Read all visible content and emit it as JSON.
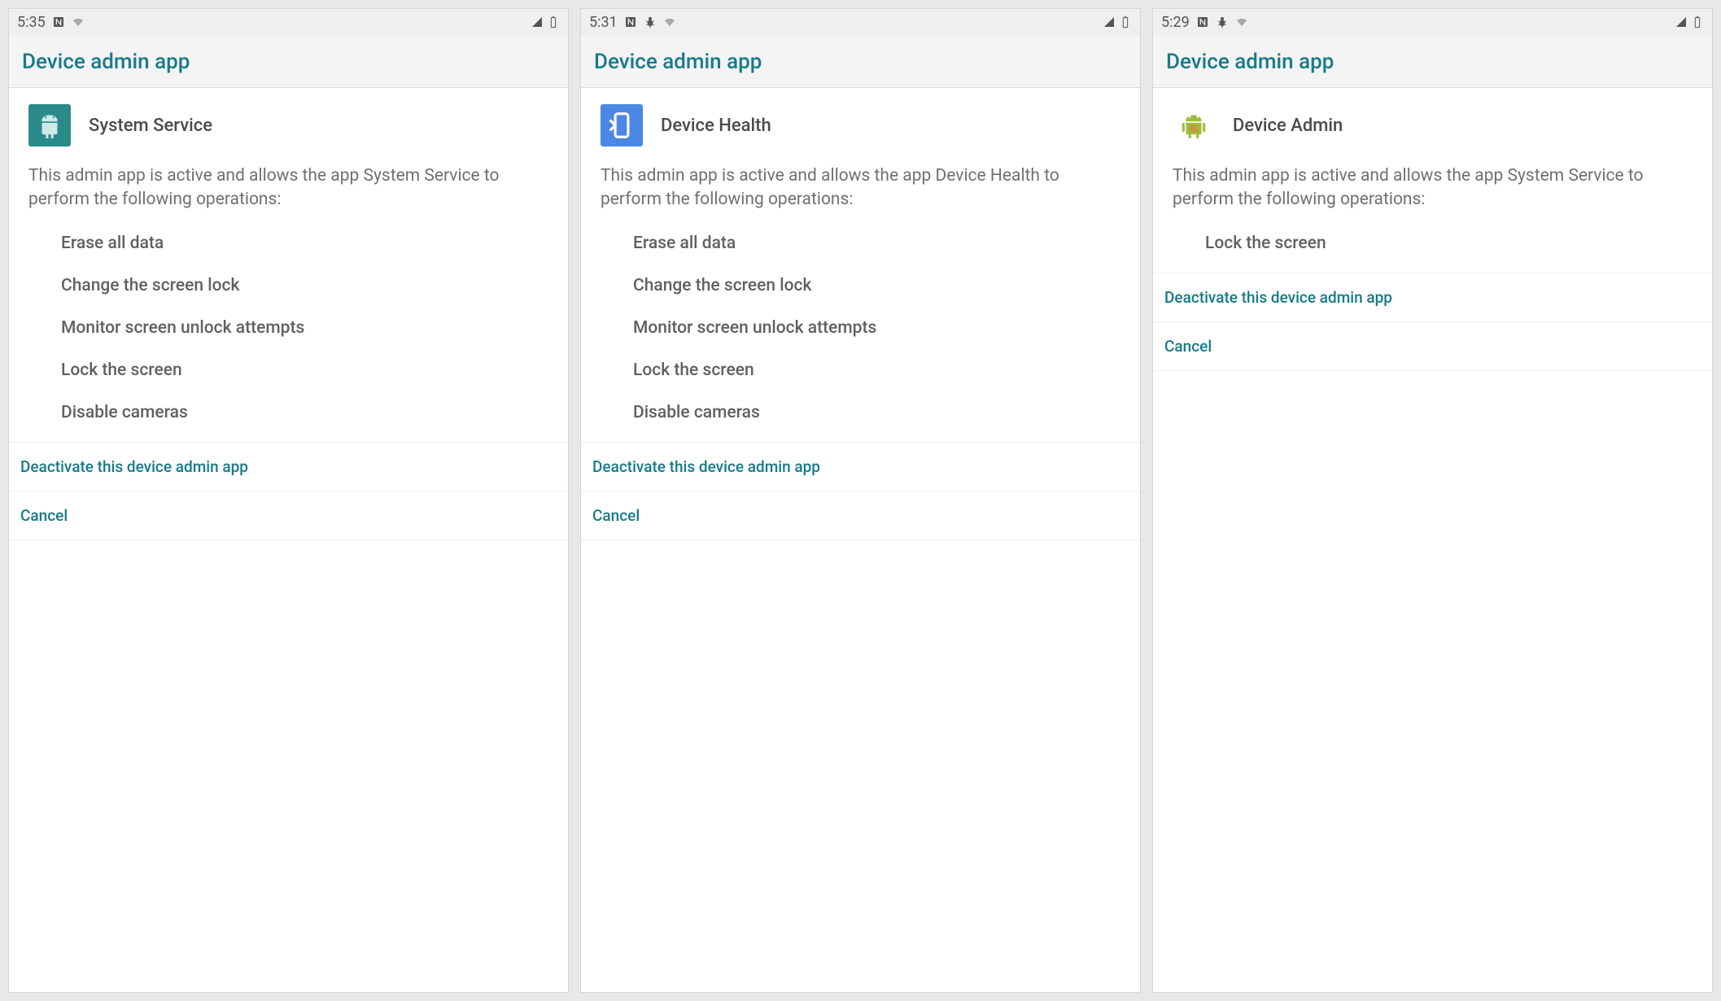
{
  "screens": [
    {
      "time": "5:35",
      "status_icons": {
        "has_bug": false
      },
      "header_title": "Device admin app",
      "app_name": "System Service",
      "app_icon": "android-teal",
      "description": "This admin app is active and allows the app System Service to perform the following operations:",
      "operations": [
        "Erase all data",
        "Change the screen lock",
        "Monitor screen unlock attempts",
        "Lock the screen",
        "Disable cameras"
      ],
      "deactivate_label": "Deactivate this device admin app",
      "cancel_label": "Cancel"
    },
    {
      "time": "5:31",
      "status_icons": {
        "has_bug": true
      },
      "header_title": "Device admin app",
      "app_name": "Device Health",
      "app_icon": "phone-blue",
      "description": "This admin app is active and allows the app Device Health to perform the following operations:",
      "operations": [
        "Erase all data",
        "Change the screen lock",
        "Monitor screen unlock attempts",
        "Lock the screen",
        "Disable cameras"
      ],
      "deactivate_label": "Deactivate this device admin app",
      "cancel_label": "Cancel"
    },
    {
      "time": "5:29",
      "status_icons": {
        "has_bug": true
      },
      "header_title": "Device admin app",
      "app_name": "Device Admin",
      "app_icon": "android-green",
      "description": "This admin app is active and allows the app System Service to perform the following operations:",
      "operations": [
        "Lock the screen"
      ],
      "deactivate_label": "Deactivate this device admin app",
      "cancel_label": "Cancel"
    }
  ]
}
